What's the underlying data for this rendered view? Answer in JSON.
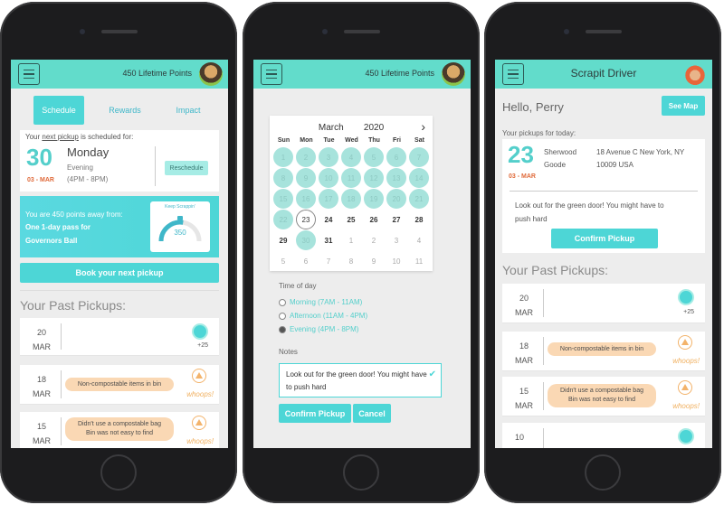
{
  "phone1": {
    "points": "450 Lifetime Points",
    "tabs": [
      "Schedule",
      "Rewards",
      "Impact"
    ],
    "next_pickup_prefix": "Your ",
    "next_pickup_link": "next pickup",
    "next_pickup_suffix": " is scheduled for:",
    "date_day": "30",
    "date_label": "03 - MAR",
    "weekday": "Monday",
    "time_of_day": "Evening",
    "time_range": "(4PM - 8PM)",
    "reschedule": "Reschedule",
    "points_away_line1": "You are 450 points away from:",
    "points_away_line2": "One 1-day pass for",
    "points_away_line3": "Governors Ball",
    "gauge_title": "Keep Scrappin'",
    "gauge_value": "350",
    "gauge_fraction": 0.55,
    "book_btn": "Book your next pickup",
    "past_title": "Your Past Pickups:",
    "past": [
      {
        "day": "20",
        "mon": "MAR",
        "type": "good",
        "pts": "+25"
      },
      {
        "day": "18",
        "mon": "MAR",
        "type": "bad",
        "msg1": "Non-compostable items in bin",
        "msg2": "",
        "whoops": "whoops!"
      },
      {
        "day": "15",
        "mon": "MAR",
        "type": "bad",
        "msg1": "Didn't use a compostable bag",
        "msg2": "Bin was not easy to find",
        "whoops": "whoops!"
      }
    ]
  },
  "phone2": {
    "points": "450 Lifetime Points",
    "month": "March",
    "year": "2020",
    "next": "›",
    "dow": [
      "Sun",
      "Mon",
      "Tue",
      "Wed",
      "Thu",
      "Fri",
      "Sat"
    ],
    "weeks": [
      [
        "1",
        "2",
        "3",
        "4",
        "5",
        "6",
        "7"
      ],
      [
        "8",
        "9",
        "10",
        "11",
        "12",
        "13",
        "14"
      ],
      [
        "15",
        "16",
        "17",
        "18",
        "19",
        "20",
        "21"
      ],
      [
        "22",
        "23",
        "24",
        "25",
        "26",
        "27",
        "28"
      ],
      [
        "29",
        "30",
        "31",
        "1",
        "2",
        "3",
        "4"
      ],
      [
        "5",
        "6",
        "7",
        "8",
        "9",
        "10",
        "11"
      ]
    ],
    "time_title": "Time of day",
    "options": [
      "Morning (7AM - 11AM)",
      "Afternoon (11AM - 4PM)",
      "Evening (4PM - 8PM)"
    ],
    "selected_option": 2,
    "notes_title": "Notes",
    "notes_text": "Look out for the green door! You might have to push hard",
    "confirm": "Confirm Pickup",
    "cancel": "Cancel"
  },
  "phone3": {
    "title": "Scrapit Driver",
    "hello": "Hello, Perry",
    "see_map": "See Map",
    "today_title": "Your pickups for today:",
    "date_day": "23",
    "date_label": "03 - MAR",
    "name1": "Sherwood",
    "name2": "Goode",
    "addr1": "18 Avenue C New York, NY",
    "addr2": "10009 USA",
    "note1": "Look out for the green door! You might have to",
    "note2": "push hard",
    "confirm": "Confirm Pickup",
    "past_title": "Your Past Pickups:",
    "past": [
      {
        "day": "20",
        "mon": "MAR",
        "type": "good",
        "pts": "+25"
      },
      {
        "day": "18",
        "mon": "MAR",
        "type": "bad",
        "msg1": "Non-compostable items in bin",
        "msg2": "",
        "whoops": "whoops!"
      },
      {
        "day": "15",
        "mon": "MAR",
        "type": "bad",
        "msg1": "Didn't use a compostable bag",
        "msg2": "Bin was not easy to find",
        "whoops": "whoops!"
      },
      {
        "day": "10",
        "mon": "",
        "type": "good",
        "pts": ""
      }
    ]
  },
  "colors": {
    "teal": "#4dd6d6",
    "topbar": "#62dccb",
    "warn": "#f3b36b",
    "pill": "#fad8b4"
  }
}
